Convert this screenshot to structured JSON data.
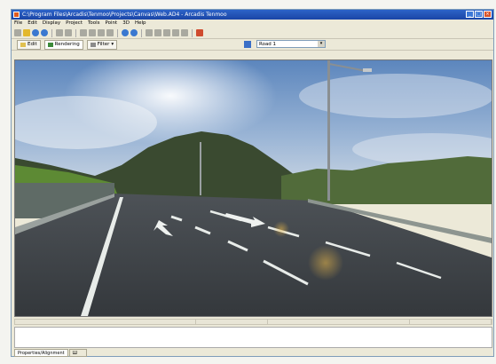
{
  "window": {
    "title": "C:\\Program Files\\Arcadis\\Tenmoo\\Projects\\Canvas\\Web.AD4 - Arcadis Tenmoo"
  },
  "menu": [
    "File",
    "Edit",
    "Display",
    "Project",
    "Tools",
    "Point",
    "3D",
    "Help"
  ],
  "toolbar_icons": [
    "new-icon",
    "open-icon",
    "save-icon",
    "save-all-icon",
    "undo-icon",
    "redo-icon",
    "cut-icon",
    "copy-icon",
    "paste-icon",
    "delete-icon",
    "globe-icon",
    "globe-alt-icon",
    "pointer-icon",
    "pencil-icon",
    "zoom-icon",
    "pan-icon",
    "search-icon",
    "tool-icon"
  ],
  "view_tabs": {
    "edit": "Edit",
    "rendering": "Rendering",
    "filter": "Filter"
  },
  "view_select": {
    "value": "Road 1"
  },
  "bottom_tabs": {
    "first": "Properties/Alignment",
    "second": "Ш"
  },
  "colors": {
    "titlebar": "#2d63c8",
    "sky": "#6f95c6",
    "road": "#3d4246",
    "grass": "#5d8a34"
  }
}
